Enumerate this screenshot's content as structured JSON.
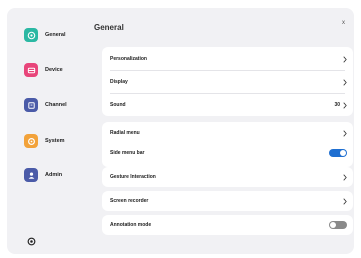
{
  "colors": {
    "accent": "#1f6fd1",
    "toggle_off": "#8a8a8a",
    "general_icon": "#2bb8a3",
    "device_icon": "#e8457a",
    "channel_icon": "#4b5ba8",
    "system_icon": "#f2a23a",
    "admin_icon": "#4b5ba8"
  },
  "sidebar": {
    "items": [
      {
        "label": "General",
        "icon": "compass-icon"
      },
      {
        "label": "Device",
        "icon": "device-icon"
      },
      {
        "label": "Channel",
        "icon": "channel-icon"
      },
      {
        "label": "System",
        "icon": "system-icon"
      },
      {
        "label": "Admin",
        "icon": "admin-icon"
      }
    ],
    "footer_icon": "gear-icon"
  },
  "header": {
    "title": "General",
    "close_label": "x"
  },
  "groups": [
    {
      "rows": [
        {
          "label": "Personalization",
          "value": "",
          "control": "chevron"
        },
        {
          "label": "Display",
          "value": "",
          "control": "chevron"
        },
        {
          "label": "Sound",
          "value": "30",
          "control": "chevron"
        }
      ]
    },
    {
      "rows": [
        {
          "label": "Radial menu",
          "value": "",
          "control": "chevron"
        },
        {
          "label": "Side menu bar",
          "value": "",
          "control": "toggle",
          "on": true
        }
      ]
    },
    {
      "rows": [
        {
          "label": "Gesture Interaction",
          "value": "",
          "control": "chevron"
        }
      ]
    },
    {
      "rows": [
        {
          "label": "Screen recorder",
          "value": "",
          "control": "chevron"
        }
      ]
    },
    {
      "rows": [
        {
          "label": "Annotation mode",
          "value": "",
          "control": "toggle",
          "on": false
        }
      ]
    }
  ]
}
